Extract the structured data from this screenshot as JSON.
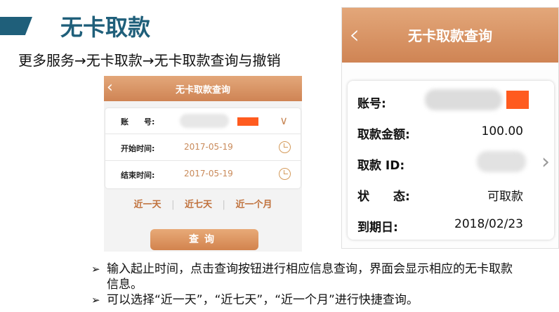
{
  "slide": {
    "title": "无卡取款",
    "breadcrumb": "更多服务→无卡取款→无卡取款查询与撤销"
  },
  "left_phone": {
    "header_title": "无卡取款查询",
    "back_icon": "‹",
    "rows": [
      {
        "label": "账　　号:",
        "value": ""
      },
      {
        "label": "开始时间:",
        "value": "2017-05-19"
      },
      {
        "label": "结束时间:",
        "value": "2017-05-19"
      }
    ],
    "quick_options": [
      "近一天",
      "近七天",
      "近一个月"
    ],
    "separator": "|",
    "query_button": "查询",
    "colors": {
      "header": "#d68c5a",
      "accent": "#c0723d",
      "redacted": "#ff5b1f"
    }
  },
  "right_phone": {
    "header_title": "无卡取款查询",
    "back_icon": "‹",
    "rows": [
      {
        "label": "账号:",
        "value": ""
      },
      {
        "label": "取款金额:",
        "value": "100.00"
      },
      {
        "label": "取款 ID:",
        "value": ""
      },
      {
        "label": "状　　态:",
        "value": "可取款"
      },
      {
        "label": "到期日:",
        "value": "2018/02/23"
      }
    ],
    "chevron_icon": "›"
  },
  "bullets": [
    {
      "mark": "➢",
      "text": "输入起止时间，点击查询按钮进行相应信息查询，界面会显示相应的无卡取款信息。"
    },
    {
      "mark": "➢",
      "text": "可以选择“近一天”，“近七天”，“近一个月”进行快捷查询。"
    }
  ]
}
